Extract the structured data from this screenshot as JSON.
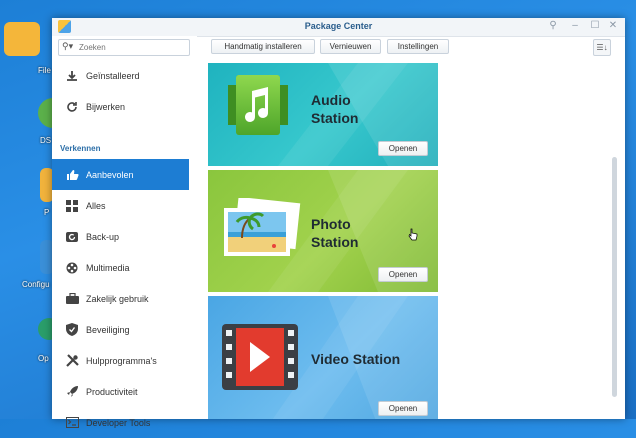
{
  "desktop": {
    "icons": [
      {
        "label": "File",
        "icon": "folder-icon"
      },
      {
        "label": "DS",
        "icon": "dsm-icon"
      },
      {
        "label": "P",
        "icon": "package-icon"
      },
      {
        "label": "Configu",
        "icon": "control-panel-icon"
      },
      {
        "label": "Op",
        "icon": "help-icon"
      }
    ]
  },
  "window": {
    "title": "Package Center",
    "controls": {
      "pin": "⚲",
      "minimize": "–",
      "maximize": "☐",
      "close": "✕"
    }
  },
  "search": {
    "placeholder": "Zoeken"
  },
  "toolbar": {
    "manual_install": "Handmatig installeren",
    "refresh": "Vernieuwen",
    "settings": "Instellingen"
  },
  "sidebar": {
    "section_label": "Verkennen",
    "top_items": [
      {
        "label": "Geïnstalleerd",
        "icon": "download-icon"
      },
      {
        "label": "Bijwerken",
        "icon": "refresh-icon"
      }
    ],
    "items": [
      {
        "label": "Aanbevolen",
        "icon": "thumbs-up-icon",
        "active": true
      },
      {
        "label": "Alles",
        "icon": "grid-icon"
      },
      {
        "label": "Back-up",
        "icon": "backup-icon"
      },
      {
        "label": "Multimedia",
        "icon": "film-reel-icon"
      },
      {
        "label": "Zakelijk gebruik",
        "icon": "briefcase-icon"
      },
      {
        "label": "Beveiliging",
        "icon": "shield-icon"
      },
      {
        "label": "Hulpprogramma's",
        "icon": "tools-icon"
      },
      {
        "label": "Productiviteit",
        "icon": "rocket-icon"
      },
      {
        "label": "Developer Tools",
        "icon": "terminal-icon"
      }
    ]
  },
  "packages": [
    {
      "name_line1": "Audio",
      "name_line2": "Station",
      "button": "Openen",
      "bg": "#2bbfc7",
      "icon": "music-note-icon"
    },
    {
      "name_line1": "Photo",
      "name_line2": "Station",
      "button": "Openen",
      "bg": "#8cc63f",
      "icon": "photo-icon"
    },
    {
      "name_line1": "Video Station",
      "name_line2": "",
      "button": "Openen",
      "bg": "#5ab1e8",
      "icon": "play-icon"
    }
  ],
  "colors": {
    "accent": "#1d7dd3",
    "desktop_bg": "#1f82d8"
  }
}
